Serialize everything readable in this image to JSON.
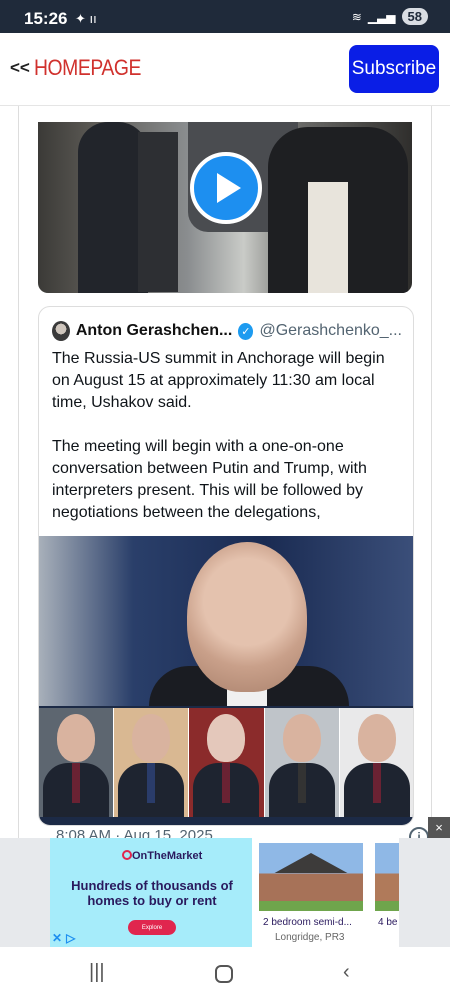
{
  "status_bar": {
    "time": "15:26",
    "battery": "58"
  },
  "header": {
    "back_chevron": "<<",
    "back_label": "HOMEPAGE",
    "subscribe_label": "Subscribe"
  },
  "tweet": {
    "author_name": "Anton Gerashchen...",
    "handle": "@Gerashchenko_...",
    "text": "The Russia-US summit in Anchorage will begin on August 15 at approximately 11:30 am local time, Ushakov said.\n\nThe meeting will begin with a one-on-one conversation between Putin and Trump, with interpreters present. This will be followed by negotiations between the delegations,",
    "timestamp": "8:08 AM · Aug 15, 2025"
  },
  "ad": {
    "brand": "OnTheMarket",
    "headline": "Hundreds of thousands of homes to buy or rent",
    "cta": "Explore",
    "listing1_title": "2 bedroom semi-d...",
    "listing1_location": "Longridge, PR3",
    "listing2_title": "4 be",
    "close_label": "×"
  },
  "colors": {
    "accent_red": "#d0312d",
    "subscribe_blue": "#0a1ee6",
    "verified_blue": "#1d9bf0"
  }
}
